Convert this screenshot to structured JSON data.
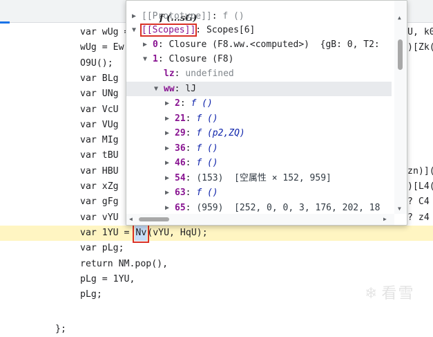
{
  "code_lines": [
    {
      "text": "var wUg =",
      "right": "U, k0",
      "kw": true
    },
    {
      "text": "wUg = Ew",
      "right": ")[Zk(",
      "kw": false
    },
    {
      "text": "O9U();",
      "right": "",
      "kw": false
    },
    {
      "text": "var BLg",
      "right": "",
      "kw": true
    },
    {
      "text": "var UNg",
      "right": "",
      "kw": true
    },
    {
      "text": "var VcU",
      "right": "",
      "kw": true
    },
    {
      "text": "var VUg",
      "right": "",
      "kw": true
    },
    {
      "text": "var MIg",
      "right": "",
      "kw": true
    },
    {
      "text": "var tBU",
      "right": "",
      "kw": true
    },
    {
      "text": "var HBU",
      "right": "zn)](",
      "kw": true
    },
    {
      "text": "var xZg",
      "right": ")[L4(",
      "kw": true
    },
    {
      "text": "var gFg",
      "right": "? C4",
      "kw": true
    },
    {
      "text": "var vYU",
      "right": "? z4",
      "kw": true
    }
  ],
  "highlight_line": {
    "pre": "var 1YU = ",
    "token": "Nv",
    "post": "(vYU, HqU);"
  },
  "after_lines": [
    "var pLg;",
    "return NM.pop(),",
    "pLg = 1YU,",
    "pLg;"
  ],
  "closing": "};",
  "popover": {
    "title": "f (...sG)",
    "rows": [
      {
        "indent": 0,
        "tri": "▶",
        "key": "[[Prototype]]",
        "sep": ": ",
        "val": "f ()",
        "style": "gray"
      },
      {
        "indent": 0,
        "tri": "▼",
        "key": "[[Scopes]]",
        "sep": ": ",
        "val": "Scopes[6]",
        "style": "scopes"
      },
      {
        "indent": 1,
        "tri": "▶",
        "key": "0",
        "sep": ": ",
        "val": "Closure (F8.ww.<computed>)  {gB: 0, T2:",
        "style": "plain"
      },
      {
        "indent": 1,
        "tri": "▼",
        "key": "1",
        "sep": ": ",
        "val": "Closure (F8)",
        "style": "plain"
      },
      {
        "indent": 2,
        "tri": "",
        "key": "lz",
        "sep": ": ",
        "val": "undefined",
        "style": "undef"
      },
      {
        "indent": 2,
        "tri": "▼",
        "key": "ww",
        "sep": ": ",
        "val": "lJ",
        "style": "sel"
      },
      {
        "indent": 3,
        "tri": "▶",
        "key": "2",
        "sep": ": ",
        "val": "f ()",
        "style": "fn"
      },
      {
        "indent": 3,
        "tri": "▶",
        "key": "21",
        "sep": ": ",
        "val": "f ()",
        "style": "fn"
      },
      {
        "indent": 3,
        "tri": "▶",
        "key": "29",
        "sep": ": ",
        "val": "f (p2,ZQ)",
        "style": "fn"
      },
      {
        "indent": 3,
        "tri": "▶",
        "key": "36",
        "sep": ": ",
        "val": "f ()",
        "style": "fn"
      },
      {
        "indent": 3,
        "tri": "▶",
        "key": "46",
        "sep": ": ",
        "val": "f ()",
        "style": "fn"
      },
      {
        "indent": 3,
        "tri": "▶",
        "key": "54",
        "sep": ": ",
        "val": "(153)  [空属性 × 152, 959]",
        "style": "arr"
      },
      {
        "indent": 3,
        "tri": "▶",
        "key": "63",
        "sep": ": ",
        "val": "f ()",
        "style": "fn"
      },
      {
        "indent": 3,
        "tri": "▶",
        "key": "65",
        "sep": ": ",
        "val": "(959)  [252, 0, 0, 3, 176, 202, 18",
        "style": "arr"
      }
    ]
  },
  "watermark": "看雪",
  "icons": {
    "expand": "triangle-right-icon",
    "collapse": "triangle-down-icon",
    "watermark": "snowflake-icon"
  }
}
